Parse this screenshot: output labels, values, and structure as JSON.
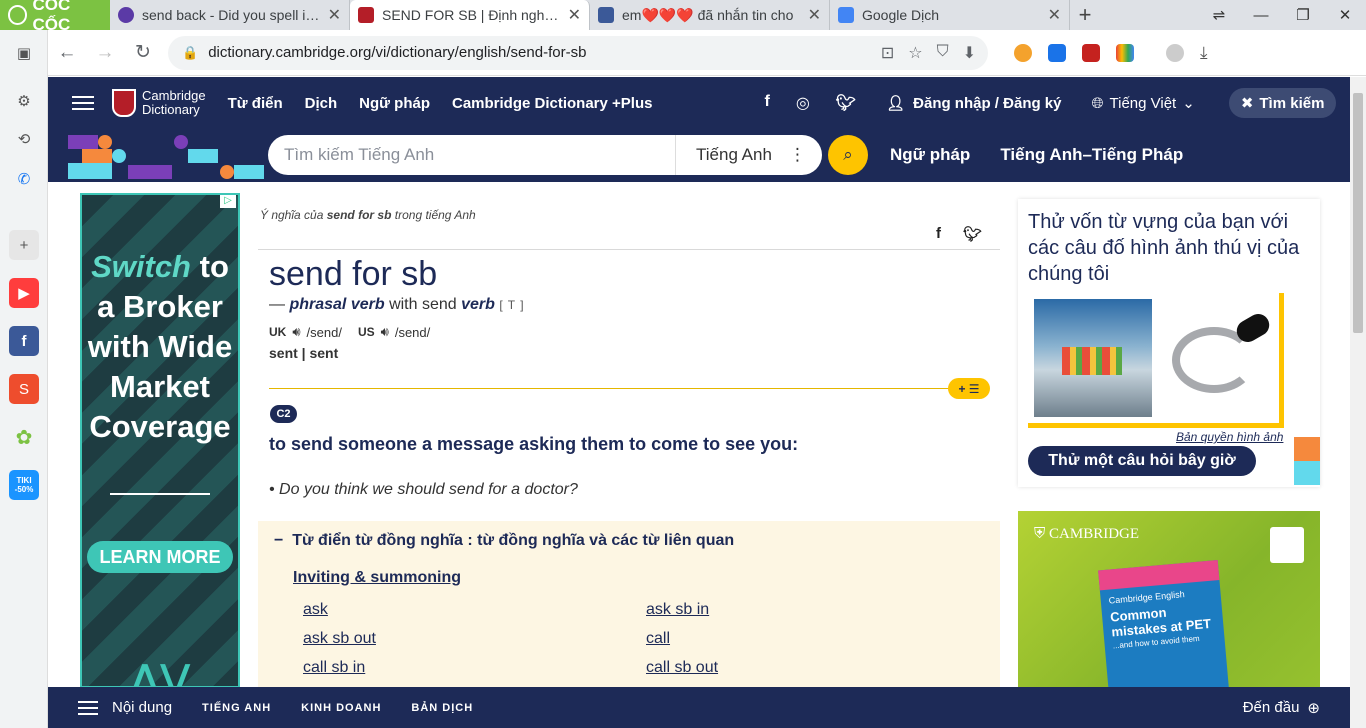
{
  "browser": {
    "brand": "CỐC CỐC",
    "tabs": [
      {
        "title": "send back - Did you spell it co",
        "favicon_color": "#5b3aa6"
      },
      {
        "title": "SEND FOR SB | Định nghĩa tro",
        "favicon_color": "#b41e28"
      },
      {
        "title": "em❤️❤️❤️ đã nhắn tin cho",
        "favicon_color": "#3b5998"
      },
      {
        "title": "Google Dịch",
        "favicon_color": "#4285f4"
      }
    ],
    "url": "dictionary.cambridge.org/vi/dictionary/english/send-for-sb"
  },
  "sidebar": {
    "tiki_label": "TIKI -50%"
  },
  "site": {
    "logo_line1": "Cambridge",
    "logo_line2": "Dictionary",
    "nav": [
      "Từ điển",
      "Dịch",
      "Ngữ pháp",
      "Cambridge Dictionary +Plus"
    ],
    "login": "Đăng nhập / Đăng ký",
    "language": "Tiếng Việt",
    "search_pill": "Tìm kiếm",
    "search_placeholder": "Tìm kiếm Tiếng Anh",
    "search_lang": "Tiếng Anh",
    "search_links": [
      "Ngữ pháp",
      "Tiếng Anh–Tiếng Pháp"
    ]
  },
  "ad_left": {
    "switch": "Switch",
    "headline": "to a Broker with Wide Market Coverage",
    "cta": "LEARN MORE"
  },
  "entry": {
    "crumb_pre": "Ý nghĩa của",
    "crumb_word": "send for sb",
    "crumb_post": "trong tiếng Anh",
    "headword": "send for sb",
    "pos_dash": "—",
    "pos": "phrasal verb",
    "pos_with": "with send",
    "pos_verb": "verb",
    "grammar": "[ T ]",
    "uk_label": "UK",
    "uk_ipa": "/send/",
    "us_label": "US",
    "us_ipa": "/send/",
    "forms": "sent | sent",
    "level": "C2",
    "definition": "to send someone a message asking them to come to see you:",
    "example": "Do you think we should send for a doctor?"
  },
  "thesaurus": {
    "title": "Từ điển từ đồng nghĩa : từ đồng nghĩa và các từ liên quan",
    "category": "Inviting & summoning",
    "words": [
      "ask",
      "ask sb in",
      "ask sb out",
      "call",
      "call sb in",
      "call sb out"
    ]
  },
  "right_panel": {
    "quiz_text": "Thử vốn từ vựng của bạn với các câu đố hình ảnh thú vị của chúng tôi",
    "copyright": "Bản quyền hình ảnh",
    "button": "Thử một câu hỏi bây giờ"
  },
  "ad_right": {
    "brand": "CAMBRIDGE",
    "book_series": "Cambridge English",
    "book_title": "Common mistakes at PET",
    "book_sub": "...and how to avoid them"
  },
  "bottom_bar": {
    "menu": "Nội dung",
    "links": [
      "TIẾNG ANH",
      "KINH DOANH",
      "BẢN DỊCH"
    ],
    "top": "Đến đầu"
  }
}
